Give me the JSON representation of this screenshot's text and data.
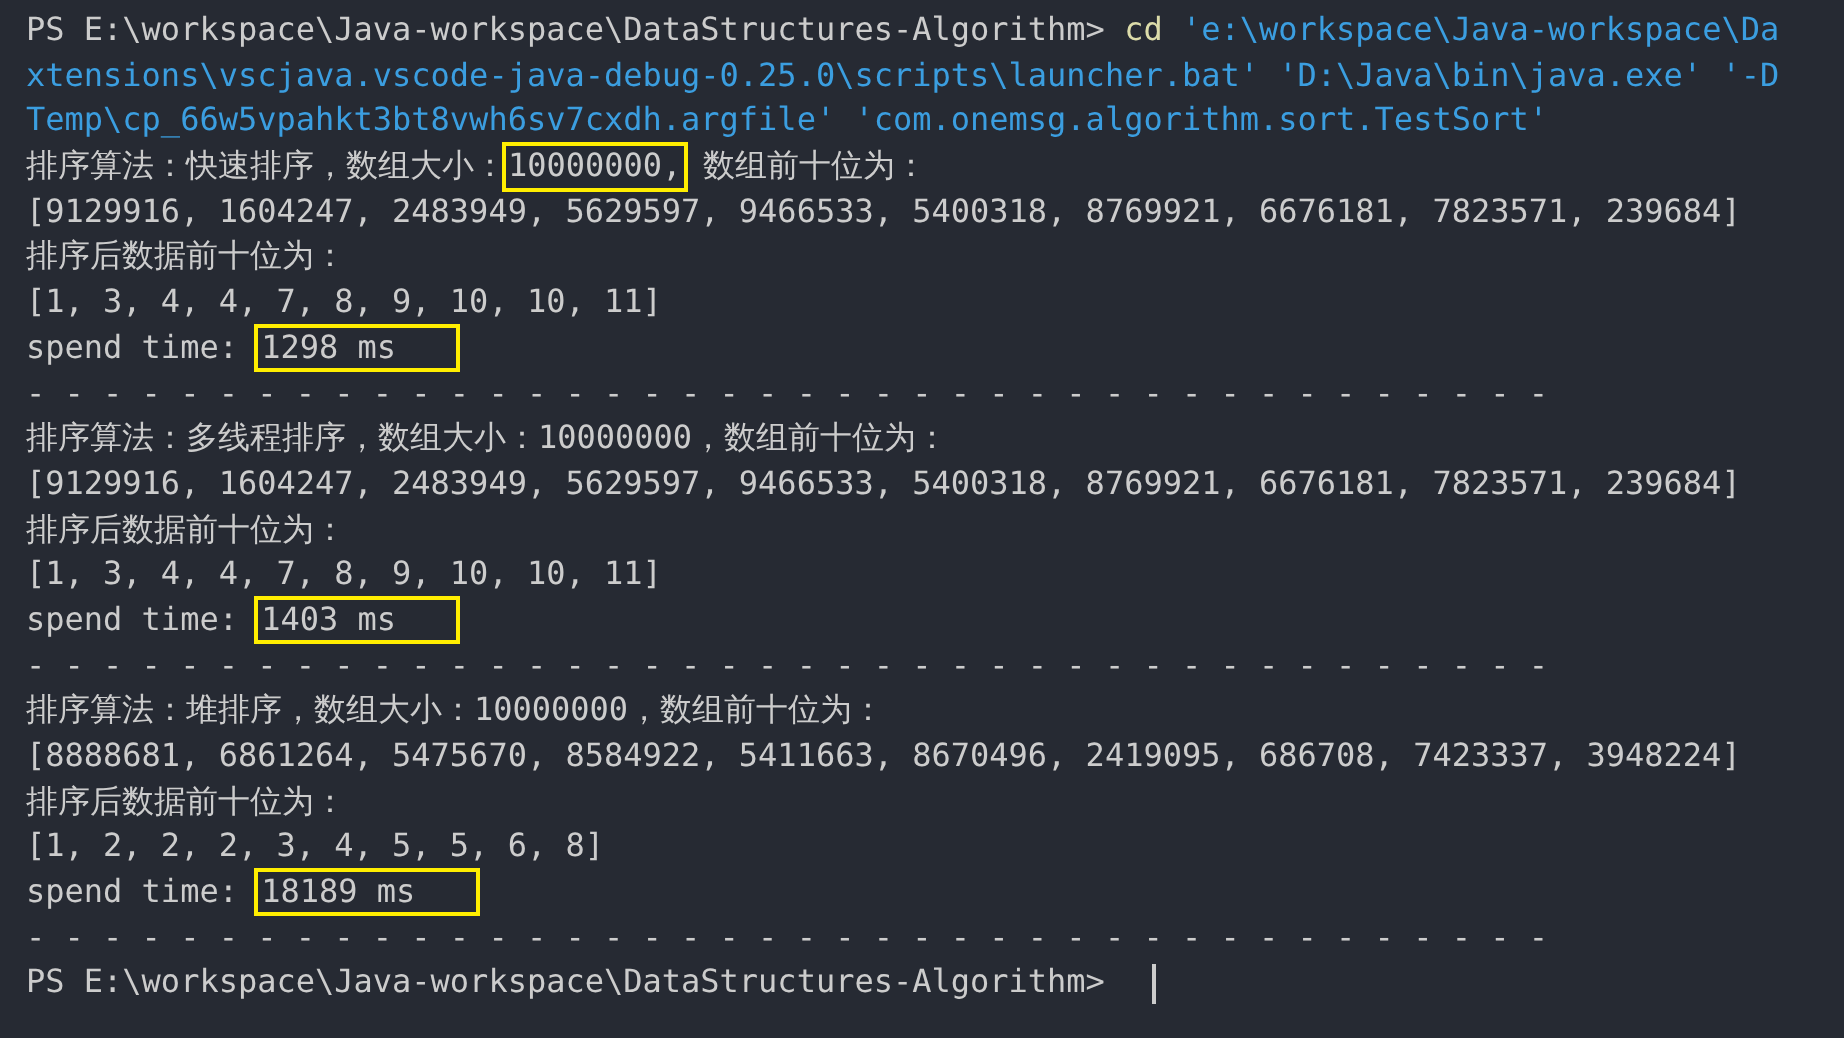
{
  "terminal": {
    "lines": [
      {
        "segments": [
          {
            "kind": "plain",
            "text": "PS E:\\workspace\\Java-workspace\\DataStructures-Algorithm> "
          },
          {
            "kind": "command",
            "text": "cd"
          },
          {
            "kind": "string",
            "text": " 'e:\\workspace\\Java-workspace\\Da"
          }
        ]
      },
      {
        "segments": [
          {
            "kind": "string",
            "text": "xtensions\\vscjava.vscode-java-debug-0.25.0\\scripts\\launcher.bat' 'D:\\Java\\bin\\java.exe' '-D"
          }
        ]
      },
      {
        "segments": [
          {
            "kind": "string",
            "text": "Temp\\cp_66w5vpahkt3bt8vwh6sv7cxdh.argfile' 'com.onemsg.algorithm.sort.TestSort'"
          }
        ]
      },
      {
        "segments": [
          {
            "kind": "plain",
            "text": "排序算法：快速排序，数组大小："
          },
          {
            "kind": "highlight",
            "text": "10000000,"
          },
          {
            "kind": "plain",
            "text": " 数组前十位为："
          }
        ]
      },
      {
        "segments": [
          {
            "kind": "plain",
            "text": "[9129916, 1604247, 2483949, 5629597, 9466533, 5400318, 8769921, 6676181, 7823571, 239684]"
          }
        ]
      },
      {
        "segments": [
          {
            "kind": "plain",
            "text": "排序后数据前十位为："
          }
        ]
      },
      {
        "segments": [
          {
            "kind": "plain",
            "text": "[1, 3, 4, 4, 7, 8, 9, 10, 10, 11]"
          }
        ]
      },
      {
        "segments": [
          {
            "kind": "plain",
            "text": "spend time: "
          },
          {
            "kind": "highlight",
            "text": "1298 ms"
          }
        ]
      },
      {
        "segments": [
          {
            "kind": "separator",
            "text": "- - - - - - - - - - - - - - - - - - - - - - - - - - - - - - - - - - - - - - - -"
          }
        ]
      },
      {
        "segments": [
          {
            "kind": "plain",
            "text": "排序算法：多线程排序，数组大小：10000000，数组前十位为："
          }
        ]
      },
      {
        "segments": [
          {
            "kind": "plain",
            "text": "[9129916, 1604247, 2483949, 5629597, 9466533, 5400318, 8769921, 6676181, 7823571, 239684]"
          }
        ]
      },
      {
        "segments": [
          {
            "kind": "plain",
            "text": "排序后数据前十位为："
          }
        ]
      },
      {
        "segments": [
          {
            "kind": "plain",
            "text": "[1, 3, 4, 4, 7, 8, 9, 10, 10, 11]"
          }
        ]
      },
      {
        "segments": [
          {
            "kind": "plain",
            "text": "spend time: "
          },
          {
            "kind": "highlight",
            "text": "1403 ms"
          }
        ]
      },
      {
        "segments": [
          {
            "kind": "separator",
            "text": "- - - - - - - - - - - - - - - - - - - - - - - - - - - - - - - - - - - - - - - -"
          }
        ]
      },
      {
        "segments": [
          {
            "kind": "plain",
            "text": "排序算法：堆排序，数组大小：10000000，数组前十位为："
          }
        ]
      },
      {
        "segments": [
          {
            "kind": "plain",
            "text": "[8888681, 6861264, 5475670, 8584922, 5411663, 8670496, 2419095, 686708, 7423337, 3948224]"
          }
        ]
      },
      {
        "segments": [
          {
            "kind": "plain",
            "text": "排序后数据前十位为："
          }
        ]
      },
      {
        "segments": [
          {
            "kind": "plain",
            "text": "[1, 2, 2, 2, 3, 4, 5, 5, 6, 8]"
          }
        ]
      },
      {
        "segments": [
          {
            "kind": "plain",
            "text": "spend time: "
          },
          {
            "kind": "highlight",
            "text": "18189 ms"
          }
        ]
      },
      {
        "segments": [
          {
            "kind": "separator",
            "text": "- - - - - - - - - - - - - - - - - - - - - - - - - - - - - - - - - - - - - - - -"
          }
        ]
      },
      {
        "segments": [
          {
            "kind": "plain",
            "text": "PS E:\\workspace\\Java-workspace\\DataStructures-Algorithm> "
          }
        ],
        "cursor": true
      }
    ]
  }
}
